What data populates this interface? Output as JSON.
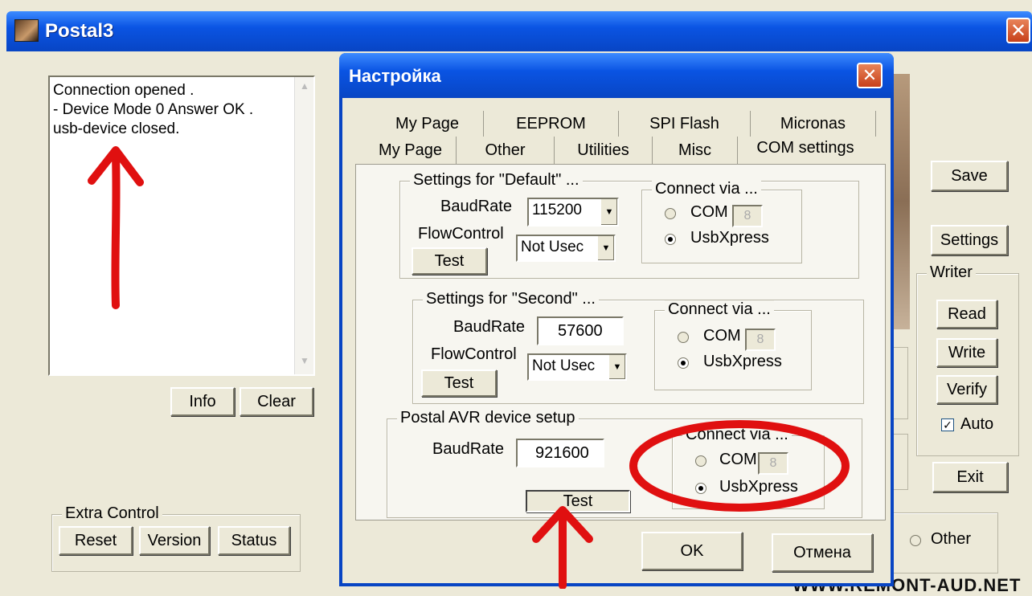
{
  "main_window": {
    "title": "Postal3",
    "log_lines": [
      "Connection opened .",
      "- Device Mode 0 Answer OK .",
      "usb-device closed."
    ],
    "info_label": "Info",
    "clear_label": "Clear",
    "extra_control": {
      "title": "Extra Control",
      "reset_label": "Reset",
      "version_label": "Version",
      "status_label": "Status"
    },
    "save_label": "Save",
    "settings_label": "Settings",
    "writer": {
      "title": "Writer",
      "read_label": "Read",
      "write_label": "Write",
      "verify_label": "Verify",
      "auto_label": "Auto",
      "auto_checked": true
    },
    "exit_label": "Exit",
    "other_label": "Other",
    "watermark": "WWW.REMONT-AUD.NET"
  },
  "dialog": {
    "title": "Настройка",
    "tabs_row1": [
      "My Page",
      "EEPROM",
      "SPI Flash",
      "Micronas"
    ],
    "tabs_row2": [
      "My Page",
      "Other",
      "Utilities",
      "Misc",
      "COM settings"
    ],
    "active_tab": "COM settings",
    "default_group": {
      "title": "Settings for \"Default\" ...",
      "baudrate_label": "BaudRate",
      "baudrate_value": "115200",
      "flowcontrol_label": "FlowControl",
      "flowcontrol_value": "Not Usec",
      "test_label": "Test",
      "connect_title": "Connect via ...",
      "com_label": "COM",
      "com_value": "8",
      "usb_label": "UsbXpress",
      "selected": "UsbXpress"
    },
    "second_group": {
      "title": "Settings for \"Second\" ...",
      "baudrate_label": "BaudRate",
      "baudrate_value": "57600",
      "flowcontrol_label": "FlowControl",
      "flowcontrol_value": "Not Usec",
      "test_label": "Test",
      "connect_title": "Connect via ...",
      "com_label": "COM",
      "com_value": "8",
      "usb_label": "UsbXpress",
      "selected": "UsbXpress"
    },
    "avr_group": {
      "title": "Postal AVR device setup",
      "baudrate_label": "BaudRate",
      "baudrate_value": "921600",
      "test_label": "Test",
      "connect_title": "Connect via ...",
      "com_label": "COM",
      "com_value": "8",
      "usb_label": "UsbXpress",
      "selected": "UsbXpress"
    },
    "ok_label": "OK",
    "cancel_label": "Отмена"
  },
  "colors": {
    "titlebar": "#0a54e3",
    "annotation_red": "#e01010",
    "window_bg": "#ece9d8"
  }
}
